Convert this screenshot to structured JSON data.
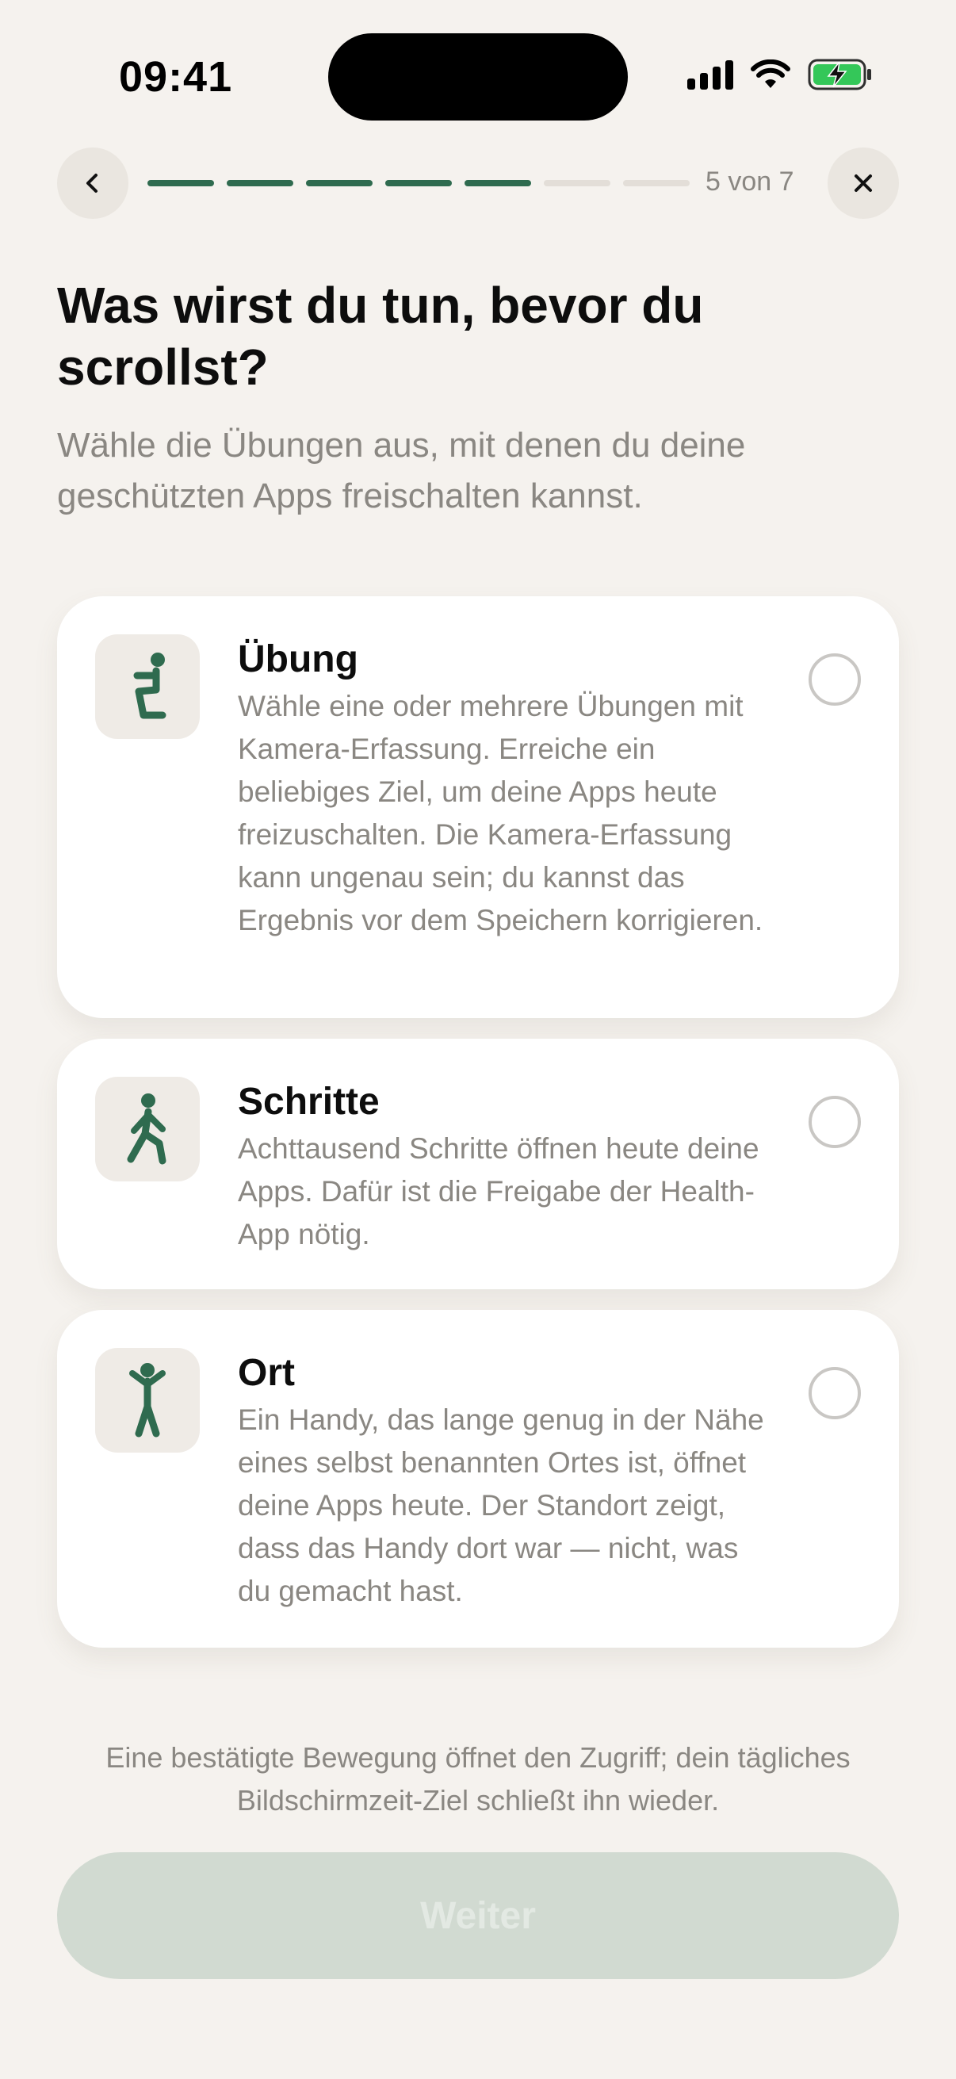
{
  "status_bar": {
    "time": "09:41"
  },
  "nav": {
    "step_label": "5 von 7",
    "total_steps": 7,
    "completed_steps": 5
  },
  "header": {
    "title": "Was wirst du tun, bevor du scrollst?",
    "subtitle": "Wähle die Übungen aus, mit denen du deine geschützten Apps freischalten kannst."
  },
  "options": [
    {
      "title": "Übung",
      "icon": "squat-figure-icon",
      "selected": false,
      "description": "Wähle eine oder mehrere Übungen mit Kamera-Erfassung. Erreiche ein beliebiges Ziel, um deine Apps heute freizuschalten. Die Kamera-Erfassung kann ungenau sein; du kannst das Ergebnis vor dem Speichern korrigieren."
    },
    {
      "title": "Schritte",
      "icon": "walking-figure-icon",
      "selected": false,
      "description": "Achttausend Schritte öffnen heute deine Apps. Dafür ist die Freigabe der Health-App nötig."
    },
    {
      "title": "Ort",
      "icon": "standing-figure-icon",
      "selected": false,
      "description": "Ein Handy, das lange genug in der Nähe eines selbst benannten Ortes ist, öffnet deine Apps heute. Der Standort zeigt, dass das Handy dort war — nicht, was du gemacht hast."
    }
  ],
  "footer": {
    "note": "Eine bestätigte Bewegung öffnet den Zugriff; dein tägliches Bildschirmzeit-Ziel schließt ihn wieder.",
    "continue_label": "Weiter"
  },
  "colors": {
    "accent": "#2F6B4F",
    "background": "#F5F2EE",
    "muted_text": "#8A8782",
    "button_disabled": "#D1DAD1"
  }
}
